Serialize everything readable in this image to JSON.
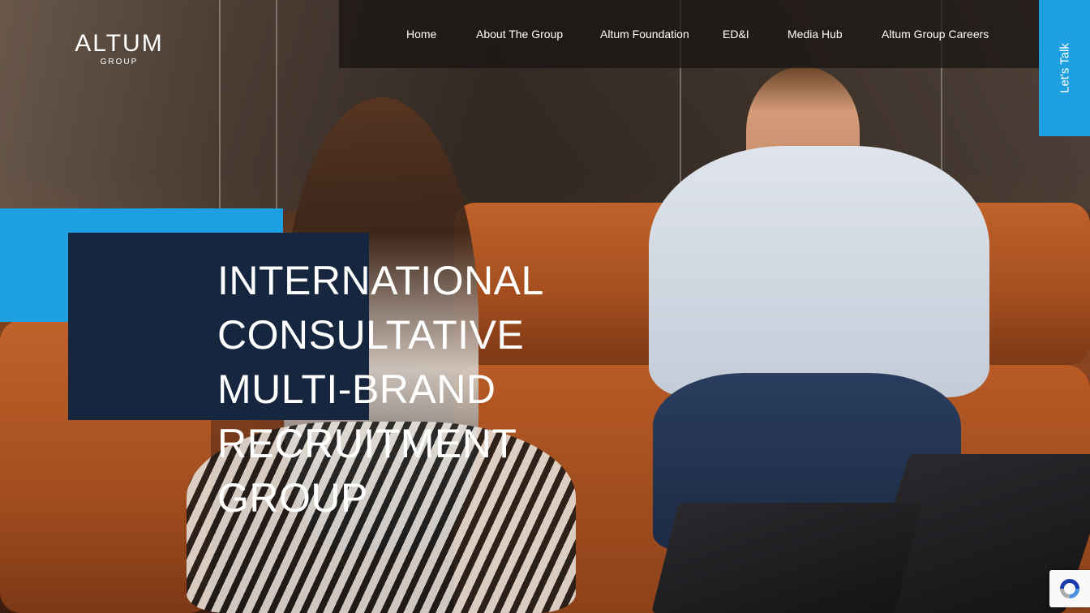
{
  "logo": {
    "name": "ALTUM",
    "subtitle": "GROUP"
  },
  "nav": {
    "items": [
      {
        "label": "Home"
      },
      {
        "label": "About The Group"
      },
      {
        "label": "Altum Foundation"
      },
      {
        "label": "ED&I"
      },
      {
        "label": "Media Hub"
      },
      {
        "label": "Altum Group Careers"
      }
    ]
  },
  "lets_talk": {
    "label": "Let's Talk"
  },
  "hero": {
    "lines": [
      "INTERNATIONAL",
      "CONSULTATIVE",
      "MULTI-BRAND",
      "RECRUITMENT",
      "GROUP"
    ]
  },
  "colors": {
    "accent_blue": "#1ea0e0",
    "navy": "#17263f",
    "nav_bg": "rgba(24,20,18,0.72)",
    "text": "#ffffff"
  },
  "icons": {
    "recaptcha": "recaptcha-icon"
  }
}
